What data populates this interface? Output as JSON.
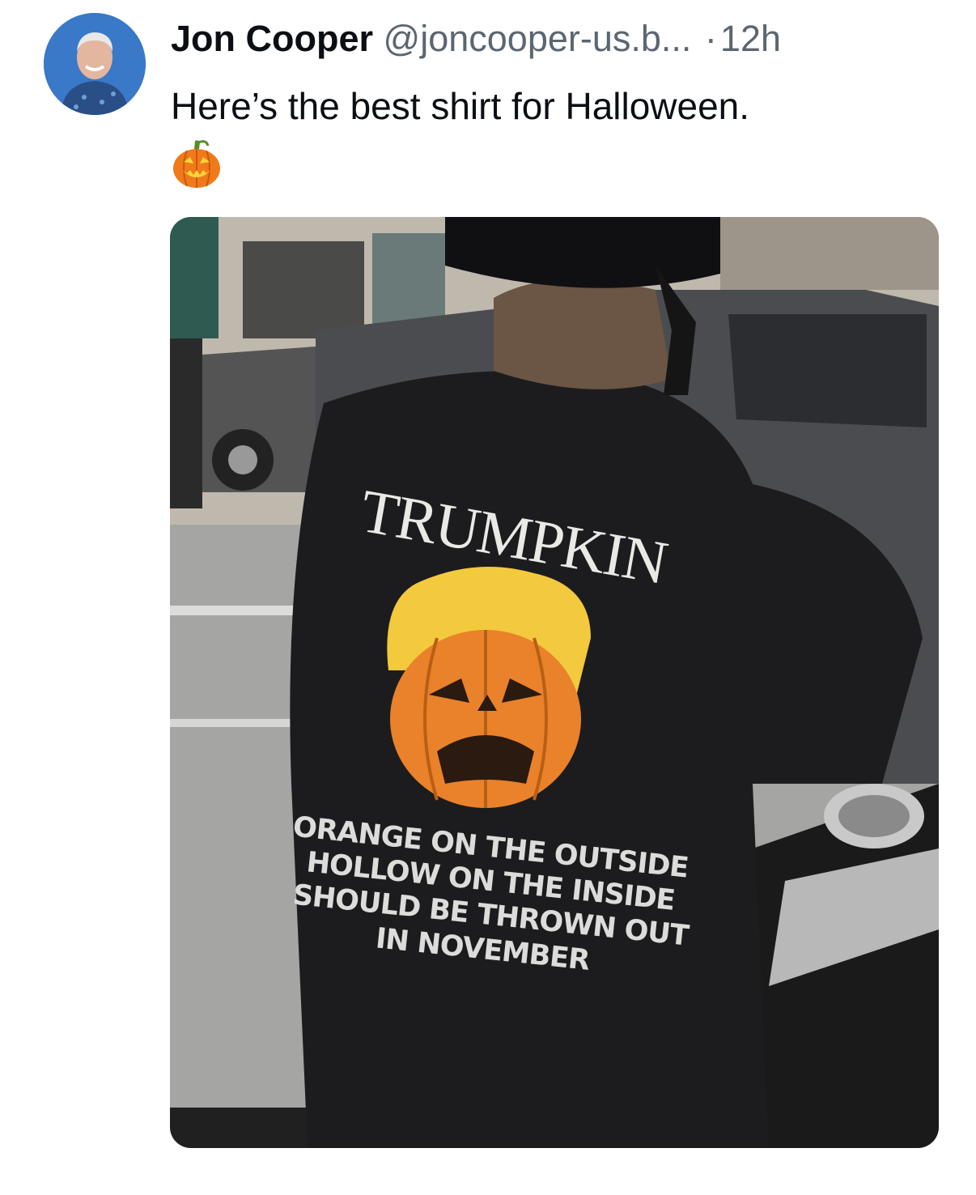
{
  "post": {
    "author_name": "Jon Cooper",
    "author_handle": "@joncooper-us.b...",
    "separator": "·",
    "time": "12h",
    "text": "Here’s the best shirt for Halloween.",
    "emoji": "jack-o-lantern-icon"
  },
  "media": {
    "shirt_title": "TRUMPKIN",
    "shirt_lines": [
      "ORANGE ON THE OUTSIDE",
      "HOLLOW ON THE INSIDE",
      "SHOULD BE THROWN OUT",
      "IN NOVEMBER"
    ]
  },
  "colors": {
    "text": "#0b0f14",
    "secondary_text": "#5b6670",
    "avatar_bg": "#3a78c8",
    "shirt": "#1c1c1e",
    "pumpkin": "#e9822a",
    "hair": "#f3c93e"
  }
}
